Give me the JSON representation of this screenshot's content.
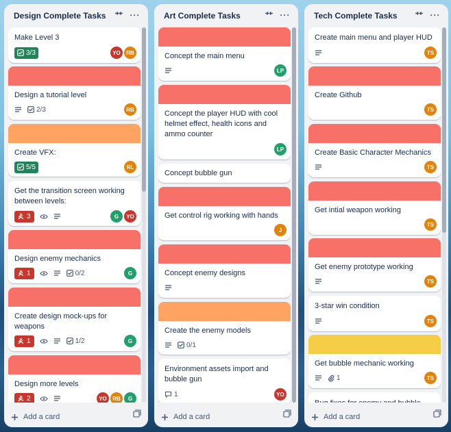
{
  "colors": {
    "red_cover": "#f87168",
    "orange_cover": "#fea362",
    "yellow_cover": "#f5cd47",
    "done_green": "#1f845a",
    "alert_red": "#c9372c"
  },
  "add_card_label": "Add a card",
  "lists": [
    {
      "title": "Design Complete Tasks",
      "cards": [
        {
          "title": "Make Level 3",
          "checklist": "3/3",
          "checklist_done": true,
          "members": [
            {
              "initials": "YO",
              "color": "#c9372c"
            },
            {
              "initials": "RB",
              "color": "#e2830e"
            }
          ]
        },
        {
          "cover": "red",
          "title": "Design a tutorial level",
          "description": true,
          "checklist": "2/3",
          "members": [
            {
              "initials": "RB",
              "color": "#e2830e"
            }
          ]
        },
        {
          "cover": "orange",
          "title": "Create VFX:",
          "checklist": "5/5",
          "checklist_done": true,
          "members": [
            {
              "initials": "RL",
              "color": "#e2830e"
            }
          ]
        },
        {
          "title": "Get the transition screen working between levels:",
          "alert": "3",
          "watch": true,
          "description": true,
          "members": [
            {
              "initials": "G",
              "color": "#22a06b"
            },
            {
              "initials": "YO",
              "color": "#c9372c"
            }
          ]
        },
        {
          "cover": "red",
          "title": "Design enemy mechanics",
          "alert": "1",
          "watch": true,
          "description": true,
          "checklist": "0/2",
          "members": [
            {
              "initials": "G",
              "color": "#22a06b"
            }
          ]
        },
        {
          "cover": "red",
          "title": "Create design mock-ups for weapons",
          "alert": "1",
          "watch": true,
          "description": true,
          "checklist": "1/2",
          "members": [
            {
              "initials": "G",
              "color": "#22a06b"
            }
          ]
        },
        {
          "cover": "red",
          "title": "Design more levels",
          "alert": "2",
          "watch": true,
          "description": true,
          "members": [
            {
              "initials": "YO",
              "color": "#c9372c"
            },
            {
              "initials": "RB",
              "color": "#e2830e"
            },
            {
              "initials": "G",
              "color": "#22a06b"
            }
          ]
        }
      ]
    },
    {
      "title": "Art Complete Tasks",
      "cards": [
        {
          "cover": "red",
          "title": "Concept the main menu",
          "description": true,
          "members": [
            {
              "initials": "LP",
              "color": "#22a06b"
            }
          ]
        },
        {
          "cover": "red",
          "title": "Concept the player HUD with cool helmet effect, health icons and ammo counter",
          "members": [
            {
              "initials": "LP",
              "color": "#22a06b"
            }
          ]
        },
        {
          "title": "Concept bubble gun"
        },
        {
          "cover": "red",
          "title": "Get control rig working with hands",
          "members": [
            {
              "initials": "J",
              "color": "#e2830e"
            }
          ]
        },
        {
          "cover": "red",
          "title": "Concept enemy designs",
          "description": true
        },
        {
          "cover": "orange",
          "title": "Create the enemy models",
          "description": true,
          "checklist": "0/1"
        },
        {
          "title": "Environment assets import and bubble gun",
          "comments": "1",
          "members": [
            {
              "initials": "YO",
              "color": "#c9372c"
            }
          ]
        }
      ]
    },
    {
      "title": "Tech Complete Tasks",
      "cards": [
        {
          "title": "Create main menu and player HUD",
          "description": true,
          "members": [
            {
              "initials": "TS",
              "color": "#e2830e"
            }
          ]
        },
        {
          "cover": "red",
          "title": "Create Github",
          "members": [
            {
              "initials": "TS",
              "color": "#e2830e"
            }
          ]
        },
        {
          "cover": "red",
          "title": "Create Basic Character Mechanics",
          "description": true,
          "members": [
            {
              "initials": "TS",
              "color": "#e2830e"
            }
          ]
        },
        {
          "cover": "red",
          "title": "Get intial weapon working",
          "members": [
            {
              "initials": "TS",
              "color": "#e2830e"
            }
          ]
        },
        {
          "cover": "red",
          "title": "Get enemy prototype working",
          "description": true,
          "members": [
            {
              "initials": "TS",
              "color": "#e2830e"
            }
          ]
        },
        {
          "title": "3-star win condition",
          "description": true,
          "members": [
            {
              "initials": "TS",
              "color": "#e2830e"
            }
          ]
        },
        {
          "cover": "yellow",
          "title": "Get bubble mechanic working",
          "description": true,
          "attachments": "1",
          "members": [
            {
              "initials": "TS",
              "color": "#e2830e"
            }
          ]
        },
        {
          "title": "Bug fixes for enemy and bubble"
        }
      ]
    }
  ]
}
